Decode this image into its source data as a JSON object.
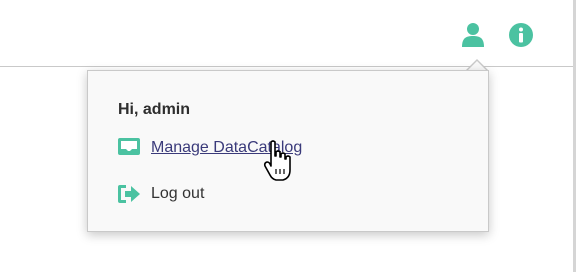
{
  "colors": {
    "accent": "#4bc2a1",
    "link": "#3a3a7a",
    "text": "#333333"
  },
  "header": {
    "user_icon": "user-icon",
    "info_icon": "info-icon"
  },
  "user_menu": {
    "greeting": "Hi, admin",
    "items": [
      {
        "label": "Manage DataCatalog",
        "icon": "inbox-icon"
      },
      {
        "label": "Log out",
        "icon": "sign-out-icon"
      }
    ]
  },
  "pointer": "hand-cursor"
}
